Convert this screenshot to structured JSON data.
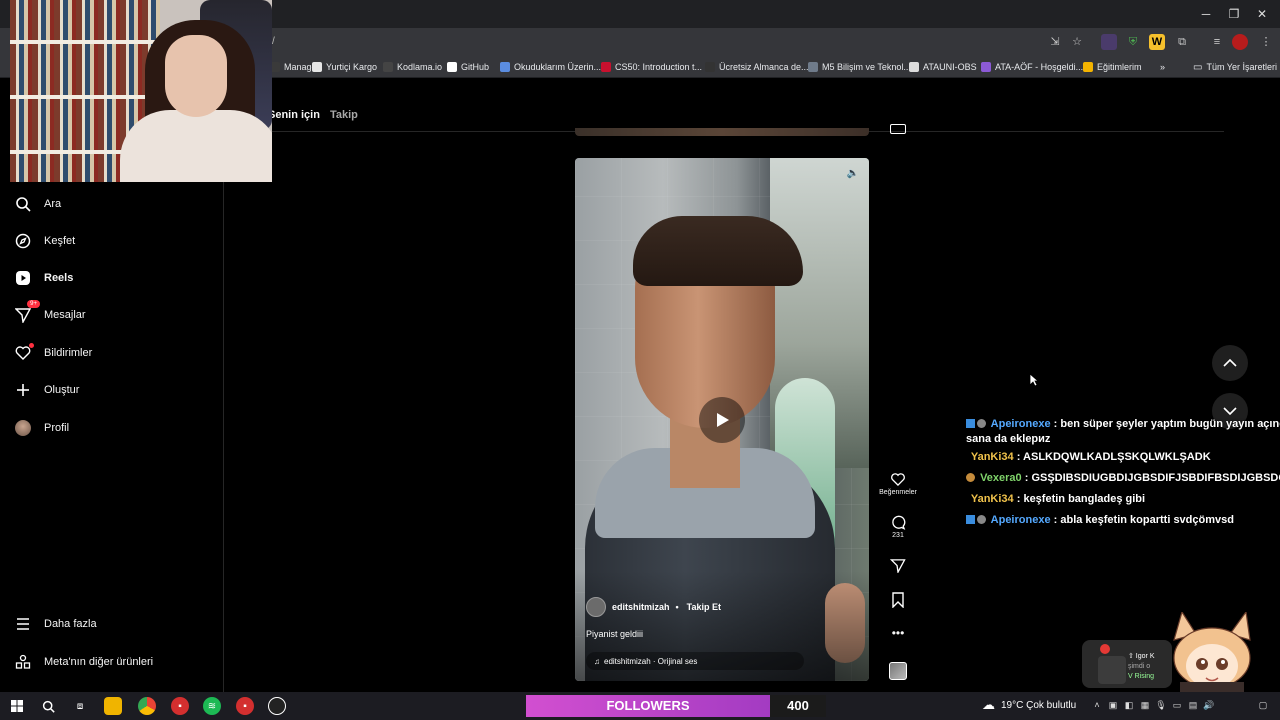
{
  "browser": {
    "address_text": "/",
    "window_controls": {
      "minimize": "─",
      "maximize": "❐",
      "close": "✕"
    },
    "bookmarks": [
      {
        "label": "Manager",
        "color": "#3a3a3a"
      },
      {
        "label": "Yurtiçi Kargo",
        "color": "#e6e6e6"
      },
      {
        "label": "Kodlama.io",
        "color": "#444444"
      },
      {
        "label": "GitHub",
        "color": "#ffffff"
      },
      {
        "label": "Okuduklarım Üzerin...",
        "color": "#5b8de0"
      },
      {
        "label": "CS50: Introduction t...",
        "color": "#c8102e"
      },
      {
        "label": "Ücretsiz Almanca de...",
        "color": "#333333"
      },
      {
        "label": "M5 Bilişim ve Teknol...",
        "color": "#6f7b8a"
      },
      {
        "label": "ATAUNI-OBS",
        "color": "#dddddd"
      },
      {
        "label": "ATA-AÖF - Hoşgeldi...",
        "color": "#8c5ad6"
      },
      {
        "label": "Eğitimlerim",
        "color": "#f4b400"
      }
    ],
    "more_bookmarks": "»",
    "all_bookmarks": "Tüm Yer İşaretleri"
  },
  "feed_tabs": {
    "for_you": "Senin için",
    "following": "Takip"
  },
  "sidebar": {
    "items": [
      {
        "label": "Ara",
        "icon": "search-icon",
        "bold": false
      },
      {
        "label": "Keşfet",
        "icon": "compass-icon",
        "bold": false
      },
      {
        "label": "Reels",
        "icon": "reels-icon",
        "bold": true
      },
      {
        "label": "Mesajlar",
        "icon": "messenger-icon",
        "bold": false
      },
      {
        "label": "Bildirimler",
        "icon": "heart-icon",
        "bold": false
      },
      {
        "label": "Oluştur",
        "icon": "plus-icon",
        "bold": false
      },
      {
        "label": "Profil",
        "icon": "avatar",
        "bold": false
      }
    ],
    "messages_badge": "9+",
    "more": "Daha fazla",
    "meta": "Meta'nın diğer ürünleri"
  },
  "reel": {
    "author": "editshitmizah",
    "separator": "•",
    "follow": "Takip Et",
    "caption": "Piyanist geldiii",
    "audio": "editshitmizah · Orijinal ses",
    "actions": {
      "like_label": "Beğenmeler",
      "comment_count": "231"
    }
  },
  "chat": [
    {
      "user": "Apeironexe",
      "color": "blue",
      "badges": 2,
      "text": " : ben süper şeyler yaptım bugün yayın açınca",
      "cont": "sana da eklериz"
    },
    {
      "user": "YanKi34",
      "color": "yellow",
      "badges": 0,
      "text": " : ASLKDQWLKADLŞSKQLWKLŞADK"
    },
    {
      "user": "Vexera0",
      "color": "green",
      "badges": 1,
      "text": " : GSŞDIBSDIUGBDIJGBSDIFJSBDIFBSDIJGBSDG"
    },
    {
      "user": "YanKi34",
      "color": "yellow",
      "badges": 0,
      "text": " : keşfetin bangladeş gibi"
    },
    {
      "user": "Apeironexe",
      "color": "blue",
      "badges": 2,
      "text": " : abla keşfetin kopartti svdçömvsd"
    }
  ],
  "followers_bar": {
    "label": "FOLLOWERS",
    "count": "400"
  },
  "alert": {
    "line1": "⇧ Igor K",
    "line2": "şimdi o",
    "line3": "V Rising"
  },
  "taskbar": {
    "weather": "19°C  Çok bulutlu",
    "apps": [
      "start-icon",
      "search-icon",
      "task-view-icon",
      "file-explorer-icon",
      "chrome-icon",
      "app-red-icon",
      "spotify-icon",
      "app-red-2-icon",
      "obs-icon"
    ]
  }
}
